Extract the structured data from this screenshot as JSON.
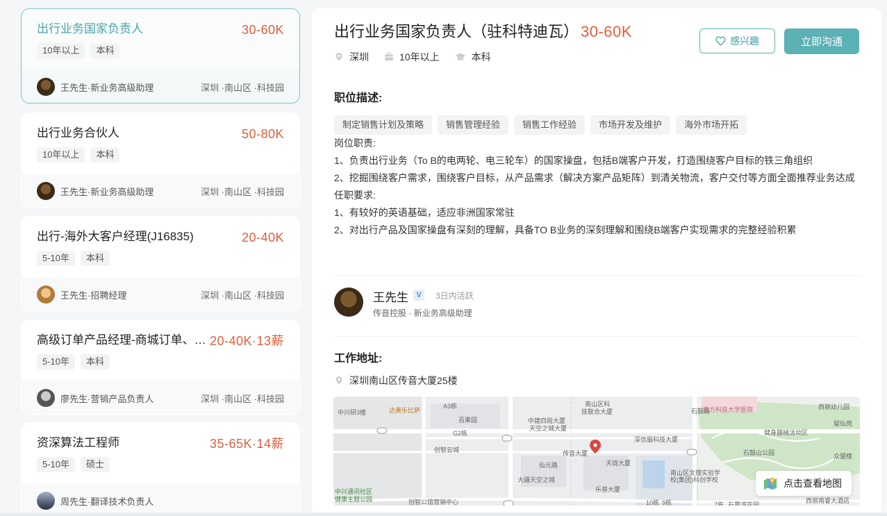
{
  "job_list": [
    {
      "title": "出行业务国家负责人",
      "salary": "30-60K",
      "tags": [
        "10年以上",
        "本科"
      ],
      "recruiter": "王先生·新业务高级助理",
      "location": "深圳 ·南山区 ·科技园"
    },
    {
      "title": "出行业务合伙人",
      "salary": "50-80K",
      "tags": [
        "10年以上",
        "本科"
      ],
      "recruiter": "王先生·新业务高级助理",
      "location": "深圳 ·南山区 ·科技园"
    },
    {
      "title": "出行-海外大客户经理(J16835)",
      "salary": "20-40K",
      "tags": [
        "5-10年",
        "本科"
      ],
      "recruiter": "王先生·招聘经理",
      "location": "深圳 ·南山区 ·科技园"
    },
    {
      "title": "高级订单产品经理-商城订单、…",
      "salary": "20-40K·13薪",
      "tags": [
        "5-10年",
        "本科"
      ],
      "recruiter": "廖先生·营销产品负责人",
      "location": "深圳 ·南山区 ·科技园"
    },
    {
      "title": "资深算法工程师",
      "salary": "35-65K·14薪",
      "tags": [
        "5-10年",
        "硕士"
      ],
      "recruiter": "周先生·翻译技术负责人",
      "location": ""
    }
  ],
  "detail": {
    "title": "出行业务国家负责人（驻科特迪瓦）",
    "salary": "30-60K",
    "interest_label": "感兴趣",
    "chat_label": "立即沟通",
    "city": "深圳",
    "experience": "10年以上",
    "education": "本科",
    "desc_heading": "职位描述:",
    "skills": [
      "制定销售计划及策略",
      "销售管理经验",
      "销售工作经验",
      "市场开发及维护",
      "海外市场开拓"
    ],
    "desc_lines": [
      "岗位职责:",
      "1、负责出行业务（To B的电两轮、电三轮车）的国家操盘，包括B端客户开发，打造围绕客户目标的铁三角组织",
      "2、挖掘围绕客户需求，围绕客户目标，从产品需求（解决方案产品矩阵）到清关物流，客户交付等方面全面推荐业务达成",
      "任职要求:",
      "1、有较好的英语基础，适应非洲国家常驻",
      "2、对出行产品及国家操盘有深刻的理解，具备TO B业务的深刻理解和围绕B端客户实现需求的完整经验积累"
    ],
    "recruiter_name": "王先生",
    "verified_mark": "V",
    "active_status": "3日内活跃",
    "recruiter_company": "传音控股 · 新业务高级助理",
    "address_heading": "工作地址:",
    "address": "深圳南山区传音大厦25楼",
    "map_button": "点击查看地图",
    "map_labels": [
      "中兴研3楼",
      "达美乐比萨",
      "A3栋",
      "百果园",
      "G2栋",
      "创智云城",
      "中建四局大厦",
      "天空之城大厦",
      "南山区科",
      "技联合大厦",
      "石鼓路",
      "南方科技大学医院",
      "西丽幼儿园",
      "留仙苑",
      "健身器械活动区",
      "深信服科技大厦",
      "传音大厦",
      "天珑大厦",
      "仙元路",
      "石鼓山公园",
      "众望楼",
      "大疆天空之城",
      "乐普大厦",
      "南山区文理实验学",
      "校(集团)科创学校",
      "中兴通讯社区",
      "健康主题公园",
      "创智公馆营销中心",
      "10栋",
      "9栋",
      "7栋",
      "石厦湾花园",
      "西丽南睿大酒店"
    ]
  },
  "colors": {
    "accent": "#5cb1b4",
    "salary": "#e05e3c",
    "background": "#f4f6f8"
  }
}
